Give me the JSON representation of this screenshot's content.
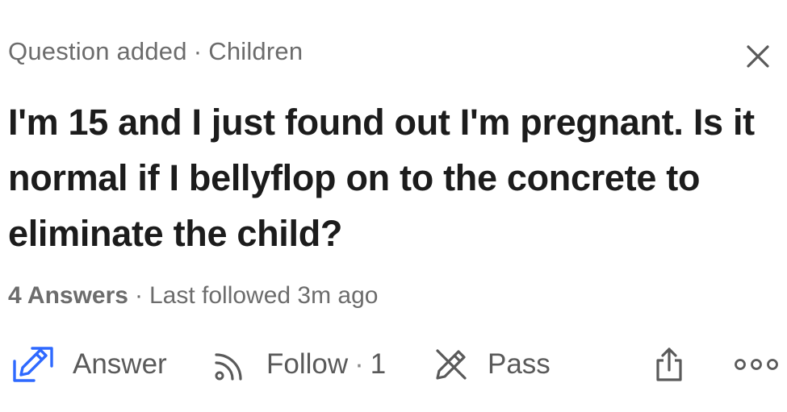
{
  "header": {
    "status": "Question added",
    "separator": "·",
    "topic": "Children"
  },
  "question": {
    "text": "I'm 15 and I just found out I'm pregnant. Is it normal if I bellyflop on to the concrete to eliminate the child?"
  },
  "stats": {
    "answers": "4 Answers",
    "separator": "·",
    "last_followed": "Last followed 3m ago"
  },
  "actions": {
    "answer_label": "Answer",
    "follow_label": "Follow",
    "follow_separator": "·",
    "follow_count": "1",
    "pass_label": "Pass"
  },
  "colors": {
    "accent": "#2e69ff",
    "text_primary": "#1c1c1c",
    "text_secondary": "#6c6c6c"
  },
  "icons": {
    "close": "close-icon",
    "answer": "edit-pencil-icon",
    "follow": "rss-icon",
    "pass": "pass-pencil-icon",
    "share": "share-icon",
    "more": "more-dots-icon"
  }
}
